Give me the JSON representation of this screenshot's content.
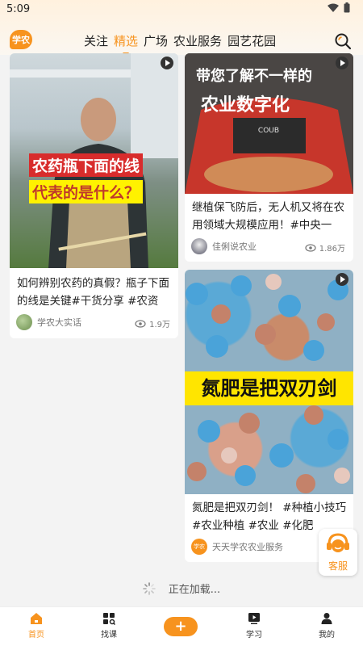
{
  "status_bar": {
    "time": "5:09"
  },
  "header": {
    "logo_text": "学农",
    "tabs": [
      {
        "label": "关注"
      },
      {
        "label": "精选",
        "active": true
      },
      {
        "label": "广场"
      },
      {
        "label": "农业服务"
      },
      {
        "label": "园艺花园"
      }
    ]
  },
  "feed": {
    "cards": [
      {
        "overlay_line1": "农药瓶下面的线",
        "overlay_line2": "代表的是什么？",
        "title": "如何辨别农药的真假？瓶子下面的线是关键#干货分享 #农资 #...",
        "author": "学农大实话",
        "views": "1.9万"
      },
      {
        "overlay_line1": "带您了解不一样的",
        "overlay_line2": "农业数字化",
        "title": "继植保飞防后，无人机又将在农用领域大规模应用！#中央一号...",
        "author": "佳俐说农业",
        "views": "1.86万"
      },
      {
        "overlay_text": "氮肥是把双刃剑",
        "title": "氮肥是把双刃剑！ #种植小技巧 #农业种植 #农业 #化肥",
        "author": "天天学农农业服务",
        "avatar_text": "学农"
      }
    ]
  },
  "loading_text": "正在加载...",
  "customer_service": {
    "label": "客服"
  },
  "bottom_nav": {
    "items": [
      {
        "label": "首页",
        "active": true
      },
      {
        "label": "找课"
      },
      {
        "label": "学习"
      },
      {
        "label": "我的"
      }
    ],
    "add_label": "+"
  },
  "colors": {
    "accent": "#f7931e",
    "background": "#f3f3f3"
  },
  "icons": [
    "wifi-icon",
    "battery-icon",
    "search-icon",
    "play-icon",
    "eye-icon",
    "loading-spinner-icon",
    "customer-service-icon",
    "home-icon",
    "grid-search-icon",
    "plus-icon",
    "video-play-icon",
    "user-icon"
  ]
}
